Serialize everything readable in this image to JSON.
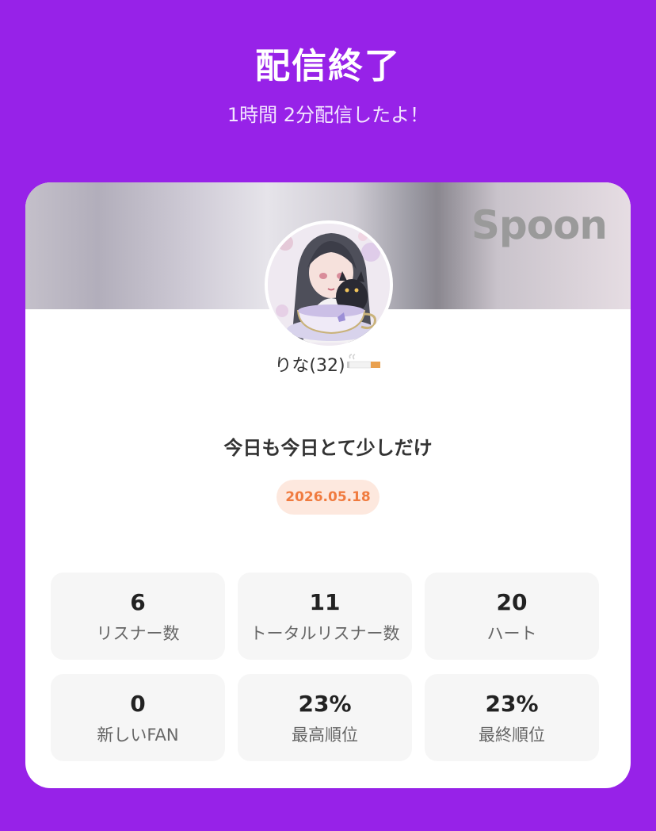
{
  "header": {
    "title": "配信終了",
    "subtitle": "1時間 2分配信したよ！"
  },
  "card": {
    "brand": "Spoon",
    "username": "りな(32)",
    "username_icon": "cigarette-emoji",
    "live_title": "今日も今日とて少しだけ",
    "date": "2026.05.18",
    "accent_color": "#f07b3f",
    "background_color": "#9722e8"
  },
  "stats": [
    {
      "value": "6",
      "label": "リスナー数"
    },
    {
      "value": "11",
      "label": "トータルリスナー数"
    },
    {
      "value": "20",
      "label": "ハート"
    },
    {
      "value": "0",
      "label": "新しいFAN"
    },
    {
      "value": "23%",
      "label": "最高順位"
    },
    {
      "value": "23%",
      "label": "最終順位"
    }
  ]
}
